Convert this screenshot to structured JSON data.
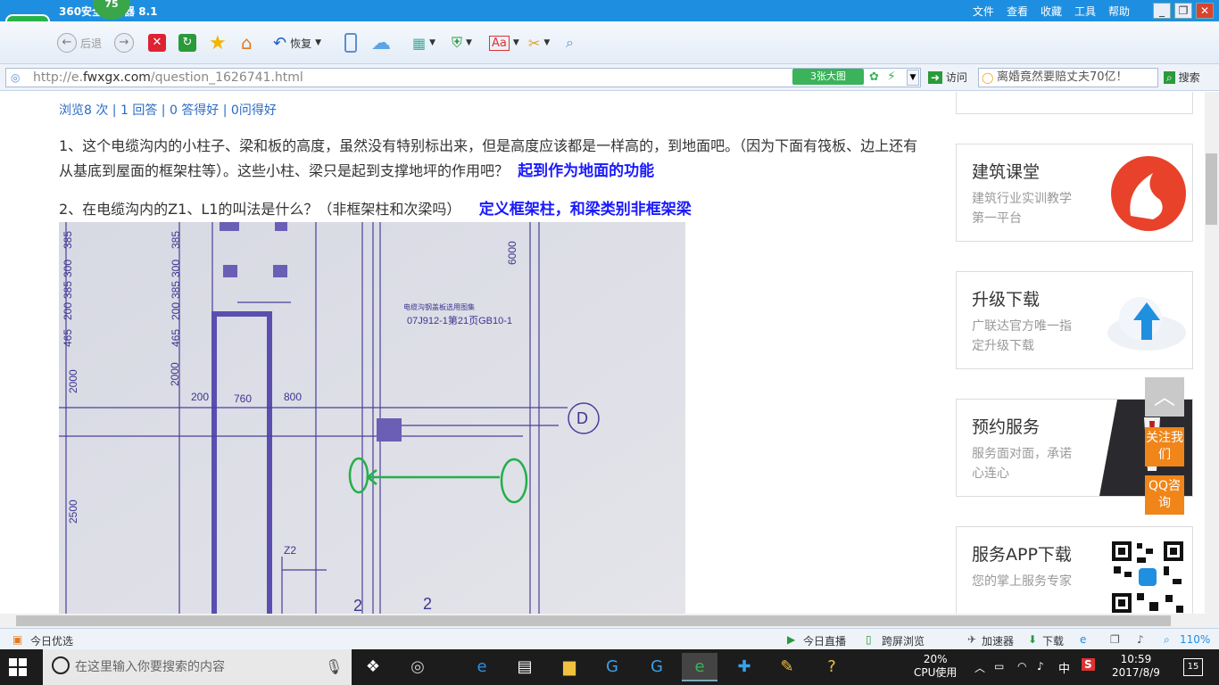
{
  "window": {
    "title": "360安全浏览器 8.1",
    "badge": "75",
    "menu": [
      "文件",
      "查看",
      "收藏",
      "工具",
      "帮助"
    ],
    "logo_letter": "e"
  },
  "toolbar": {
    "back_label": "后退",
    "restore_label": "恢复"
  },
  "address": {
    "url_prefix": "http://e.",
    "url_domain": "fwxgx.com",
    "url_path": "/question_1626741.html",
    "bigpic_label": "3张大图",
    "visit_label": "访问",
    "search_value": "离婚竟然要赔丈夫70亿！",
    "search_button": "搜索"
  },
  "content": {
    "stats": "浏览8 次 | 1 回答 | 0 答得好 | 0问得好",
    "q1": "1、这个电缆沟内的小柱子、梁和板的高度，虽然没有特别标出来，但是高度应该都是一样高的，到地面吧。（因为下面有筏板、边上还有从基底到屋面的框架柱等）。这些小柱、梁只是起到支撑地坪的作用吧？",
    "a1": "起到作为地面的功能",
    "q2": "2、在电缆沟内的Z1、L1的叫法是什么？（非框架柱和次梁吗）",
    "a2": "定义框架柱，和梁类别非框架梁",
    "drawing": {
      "dims_left_top": [
        "385",
        "300",
        "385",
        "200",
        "465",
        "385",
        "300",
        "385",
        "200",
        "465"
      ],
      "dims_mid": [
        "200",
        "760",
        "800"
      ],
      "dims_vertical": [
        "2000",
        "2000",
        "2500"
      ],
      "note_title": "电缆沟钢盖板选用图集",
      "note_ref": "07J912-1第21页GB10-1",
      "axis_label": "D",
      "right_dim": "6000",
      "z2": "Z2",
      "bottom_nums": [
        "2",
        "2"
      ]
    }
  },
  "sidebar": {
    "cards": [
      {
        "title": "建筑课堂",
        "sub": "建筑行业实训教学第一平台"
      },
      {
        "title": "升级下载",
        "sub": "广联达官方唯一指定升级下载"
      },
      {
        "title": "预约服务",
        "sub": "服务面对面，承诺心连心"
      },
      {
        "title": "服务APP下载",
        "sub": "您的掌上服务专家"
      }
    ],
    "follow_label": "关注我们",
    "qq_label": "QQ咨询"
  },
  "statusbar": {
    "left": "今日优选",
    "live": "今日直播",
    "cross_screen": "跨屏浏览",
    "accelerator": "加速器",
    "download": "下载",
    "zoom": "110%"
  },
  "taskbar": {
    "search_placeholder": "在这里输入你要搜索的内容",
    "cpu_percent": "20%",
    "cpu_label": "CPU使用",
    "ime": "中",
    "time": "10:59",
    "date": "2017/8/9",
    "notifications": "15"
  },
  "colors": {
    "titlebar": "#1e8fe0",
    "annotation": "#1a1aff",
    "link": "#2a6bc4",
    "float_orange": "#f08519"
  }
}
